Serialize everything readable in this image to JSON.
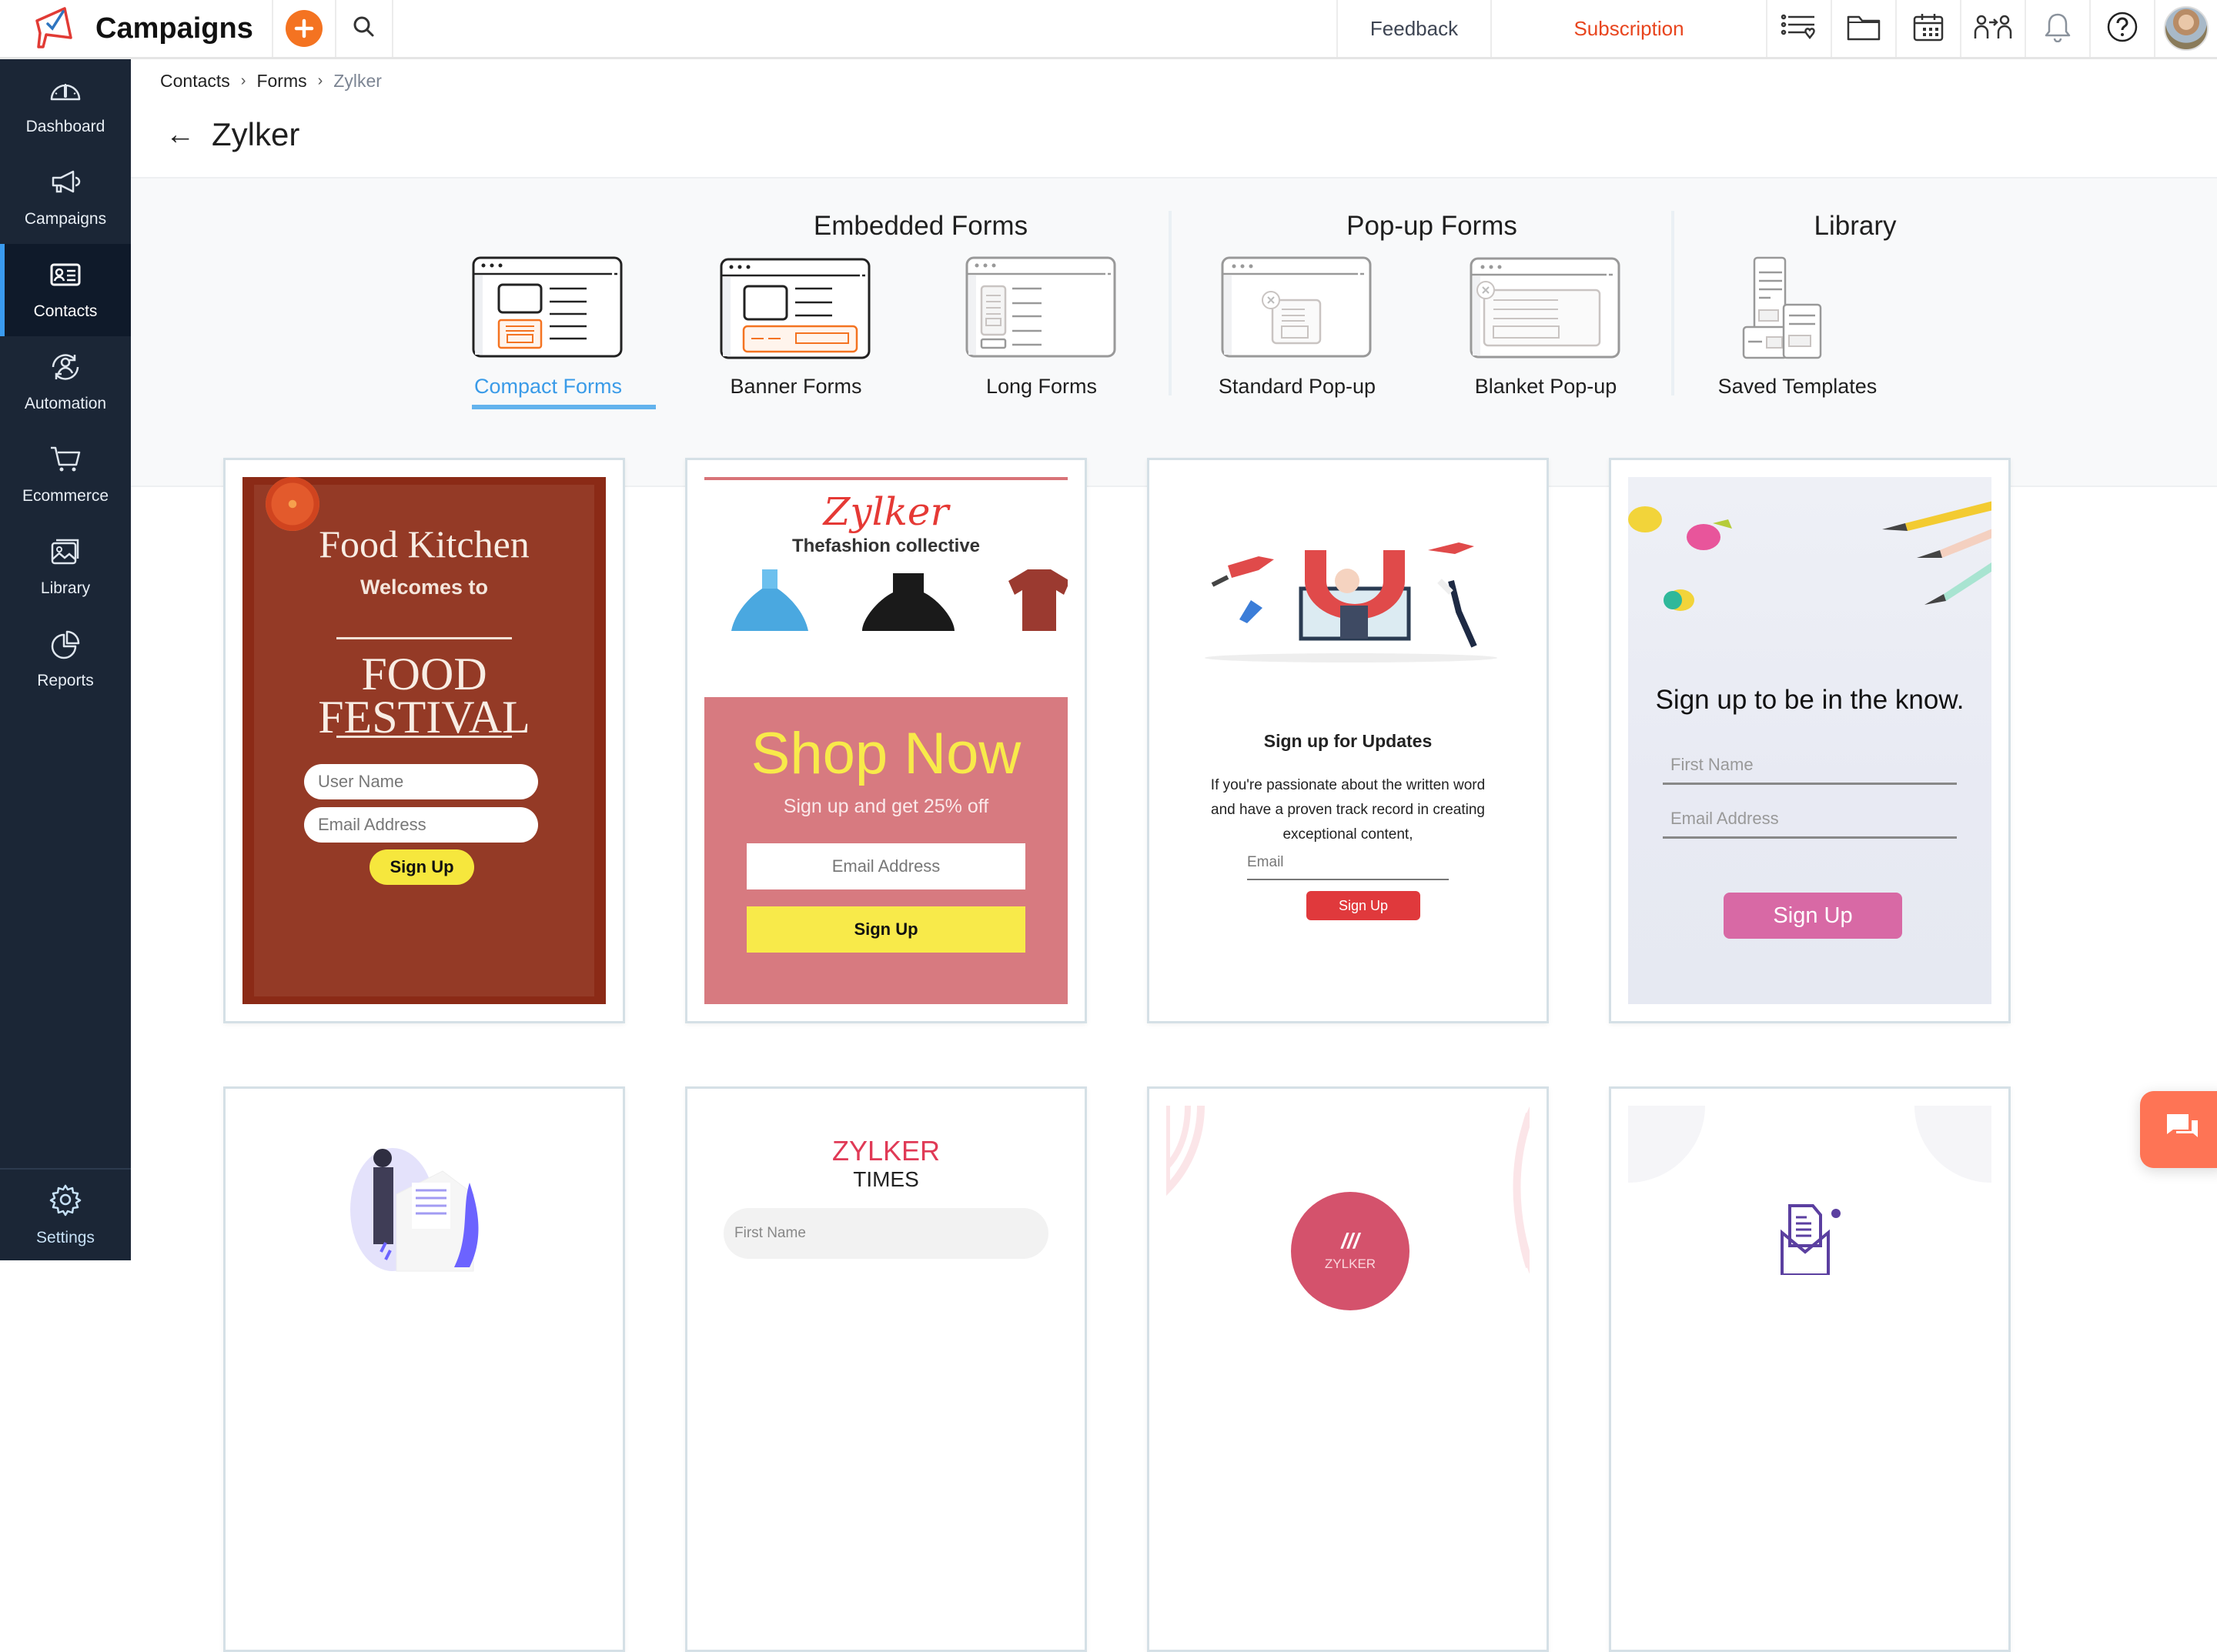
{
  "header": {
    "app_name": "Campaigns",
    "feedback_label": "Feedback",
    "subscription_label": "Subscription",
    "icons": [
      "add-icon",
      "search-icon",
      "signup-forms-icon",
      "folder-icon",
      "calendar-icon",
      "users-transfer-icon",
      "bell-icon",
      "help-icon",
      "avatar"
    ]
  },
  "sidebar": {
    "items": [
      {
        "label": "Dashboard",
        "icon": "dashboard-icon",
        "active": false
      },
      {
        "label": "Campaigns",
        "icon": "megaphone-icon",
        "active": false
      },
      {
        "label": "Contacts",
        "icon": "contact-card-icon",
        "active": true
      },
      {
        "label": "Automation",
        "icon": "automation-icon",
        "active": false
      },
      {
        "label": "Ecommerce",
        "icon": "cart-icon",
        "active": false
      },
      {
        "label": "Library",
        "icon": "images-icon",
        "active": false
      },
      {
        "label": "Reports",
        "icon": "pie-chart-icon",
        "active": false
      }
    ],
    "settings_label": "Settings"
  },
  "breadcrumb": [
    "Contacts",
    "Forms",
    "Zylker"
  ],
  "page_title": "Zylker",
  "form_groups": [
    {
      "title": "Embedded Forms",
      "tabs": [
        {
          "label": "Compact Forms",
          "active": true
        },
        {
          "label": "Banner Forms",
          "active": false
        },
        {
          "label": "Long Forms",
          "active": false
        }
      ]
    },
    {
      "title": "Pop-up Forms",
      "tabs": [
        {
          "label": "Standard Pop-up",
          "active": false
        },
        {
          "label": "Blanket Pop-up",
          "active": false
        }
      ]
    },
    {
      "title": "Library",
      "tabs": [
        {
          "label": "Saved Templates",
          "active": false
        }
      ]
    }
  ],
  "templates": [
    {
      "name": "food-kitchen",
      "title": "Food Kitchen",
      "subtitle": "Welcomes to",
      "headline_1": "FOOD",
      "headline_2": "FESTIVAL",
      "field_1": "User Name",
      "field_2": "Email Address",
      "button": "Sign Up"
    },
    {
      "name": "zylker-fashion",
      "logo": "Zylker",
      "tagline": "Thefashion collective",
      "headline": "Shop Now",
      "subtext": "Sign up and get 25% off",
      "field_1": "Email Address",
      "button": "Sign Up"
    },
    {
      "name": "sign-up-updates",
      "title": "Sign up for Updates",
      "body": "If you're passionate about the written word and have a proven track record in creating exceptional content,",
      "field_1": "Email",
      "button": "Sign Up"
    },
    {
      "name": "in-the-know",
      "title": "Sign up to be in the know.",
      "field_1": "First Name",
      "field_2": "Email Address",
      "button": "Sign Up"
    },
    {
      "name": "envelope-illustration"
    },
    {
      "name": "zylker-times",
      "title_1": "ZYLKER",
      "title_2": "TIMES",
      "field_1": "First Name"
    },
    {
      "name": "zylker-circle",
      "logo_text": "ZYLKER"
    },
    {
      "name": "mail-icon-template"
    }
  ],
  "colors": {
    "accent_orange": "#f47321",
    "subscription_red": "#e8451e",
    "sidebar_bg": "#1b2636",
    "active_tab_blue": "#3a9be8",
    "chat_button": "#fe7455"
  }
}
